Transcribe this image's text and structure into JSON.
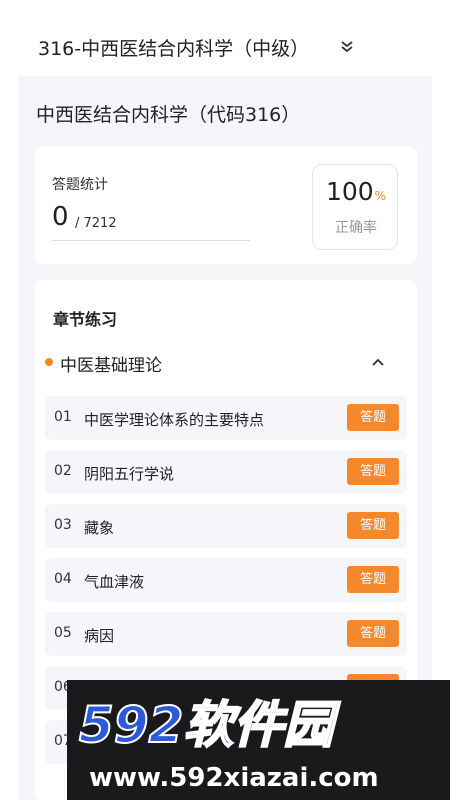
{
  "header": {
    "title": "316-中西医结合内科学（中级）",
    "dropdown_icon": "chevron-double-down-icon"
  },
  "subject": {
    "title": "中西医结合内科学（代码316）"
  },
  "stats": {
    "label": "答题统计",
    "answered": "0",
    "total": "/ 7212",
    "rate_value": "100",
    "rate_unit": "%",
    "rate_label": "正确率"
  },
  "chapters": {
    "heading": "章节练习",
    "section": {
      "title": "中医基础理论",
      "toggle_icon": "chevron-up-icon",
      "dot_color": "#f08a28"
    },
    "button_label": "答题",
    "lessons": [
      {
        "num": "01",
        "name": "中医学理论体系的主要特点"
      },
      {
        "num": "02",
        "name": "阴阳五行学说"
      },
      {
        "num": "03",
        "name": "藏象"
      },
      {
        "num": "04",
        "name": "气血津液"
      },
      {
        "num": "05",
        "name": "病因"
      },
      {
        "num": "06",
        "name": ""
      },
      {
        "num": "07",
        "name": ""
      }
    ]
  },
  "watermark": {
    "brand": "592软件园",
    "url": "www.592xiazai.com"
  },
  "colors": {
    "accent": "#f5882b",
    "background": "#f4f6fa",
    "watermark_blue": "#2b5bd8"
  }
}
